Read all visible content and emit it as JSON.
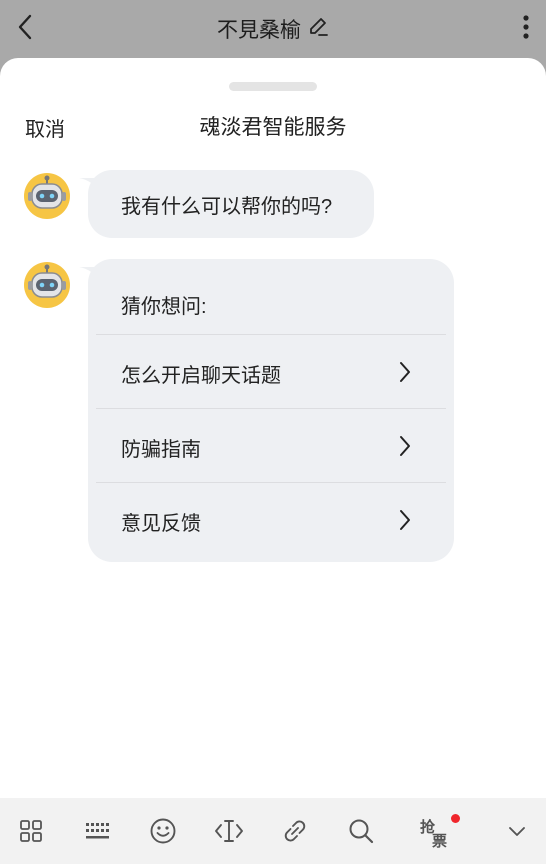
{
  "header": {
    "title": "不見桑榆"
  },
  "sheet": {
    "cancel_label": "取消",
    "title": "魂淡君智能服务"
  },
  "chat": {
    "greeting": "我有什么可以帮你的吗?",
    "suggest_heading": "猜你想问:",
    "suggestions": [
      {
        "label": "怎么开启聊天话题"
      },
      {
        "label": "防骗指南"
      },
      {
        "label": "意见反馈"
      }
    ]
  },
  "toolbar": {
    "icons": [
      "grid-icon",
      "keyboard-icon",
      "emoji-icon",
      "text-cursor-icon",
      "link-icon",
      "search-icon",
      "grab-ticket-icon",
      "chevron-down-icon"
    ],
    "grab_label_1": "抢",
    "grab_label_2": "票",
    "badge_color": "#f0262c"
  }
}
